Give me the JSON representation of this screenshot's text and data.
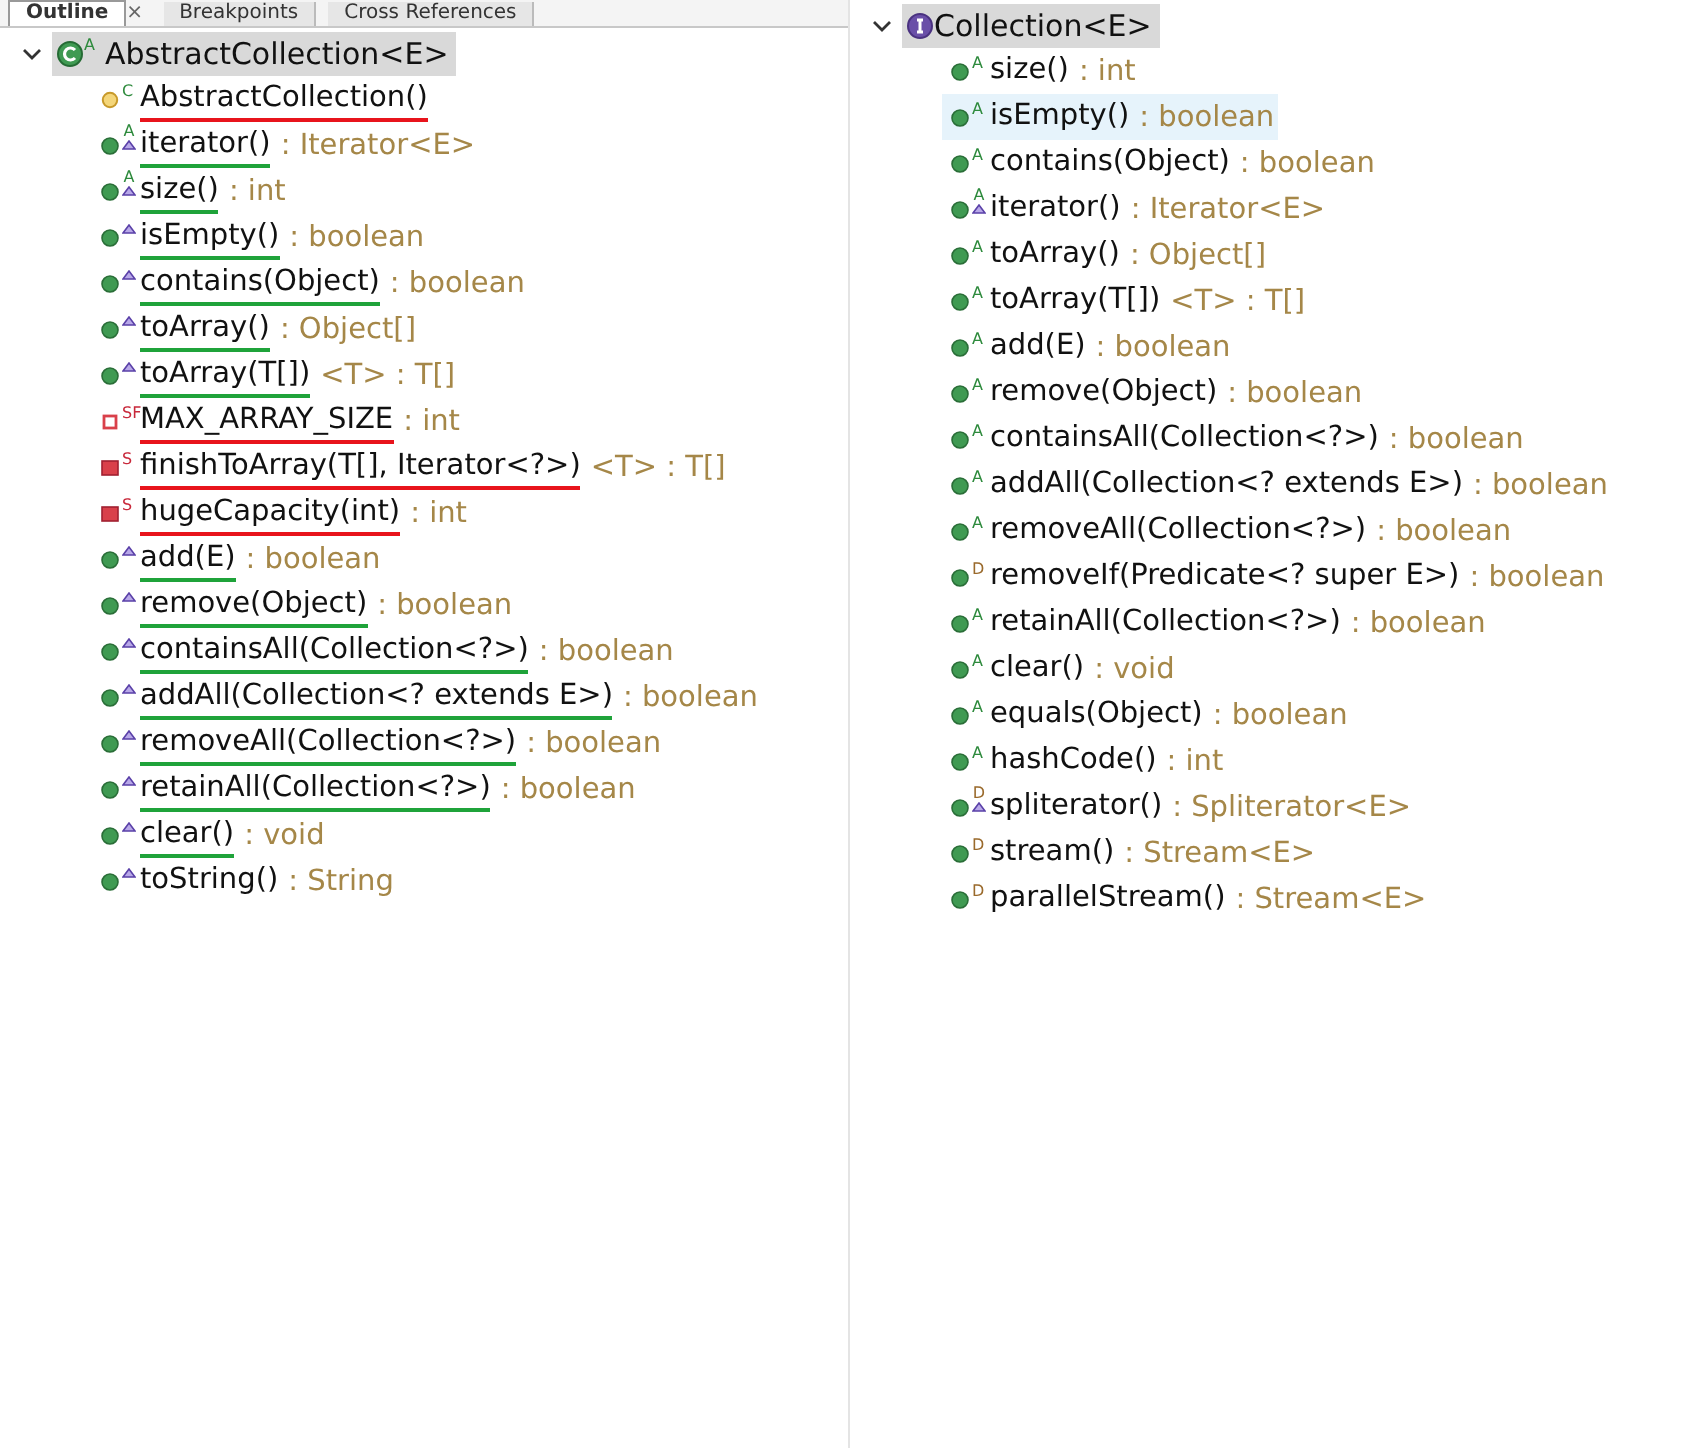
{
  "tabs": [
    {
      "label": "Outline",
      "selected": true,
      "close": "×"
    },
    {
      "label": "Breakpoints",
      "selected": false
    },
    {
      "label": "Cross References",
      "selected": false
    }
  ],
  "outline": {
    "root": {
      "label": "AbstractCollection<E>",
      "kind": "class",
      "modifier": "A",
      "expanded": true,
      "selected": true
    },
    "members": [
      {
        "signature": "AbstractCollection()",
        "kind": "constructor",
        "modifier": "C",
        "overrides": false,
        "color": "#e8141c",
        "selected": false
      },
      {
        "signature": "iterator()",
        "return": ": Iterator<E>",
        "kind": "public",
        "modifier": "A",
        "overrides": true,
        "color": "#1fa33a",
        "selected": false
      },
      {
        "signature": "size()",
        "return": ": int",
        "kind": "public",
        "modifier": "A",
        "overrides": true,
        "color": "#1fa33a",
        "selected": false
      },
      {
        "signature": "isEmpty()",
        "return": ": boolean",
        "kind": "public",
        "overrides": true,
        "color": "#1fa33a",
        "selected": false
      },
      {
        "signature": "contains(Object)",
        "return": ": boolean",
        "kind": "public",
        "overrides": true,
        "color": "#1fa33a",
        "selected": false
      },
      {
        "signature": "toArray()",
        "return": ": Object[]",
        "kind": "public",
        "overrides": true,
        "color": "#1fa33a",
        "selected": false
      },
      {
        "signature": "toArray(T[])",
        "return": "<T> : T[]",
        "kind": "public",
        "overrides": true,
        "color": "#1fa33a",
        "selected": false
      },
      {
        "signature": "MAX_ARRAY_SIZE",
        "return": ": int",
        "kind": "field",
        "modifier": "SF",
        "overrides": false,
        "color": "#e8141c",
        "selected": false
      },
      {
        "signature": "finishToArray(T[], Iterator<?>)",
        "return": "<T> : T[]",
        "kind": "private",
        "modifier": "S",
        "overrides": false,
        "color": "#e8141c",
        "selected": false
      },
      {
        "signature": "hugeCapacity(int)",
        "return": ": int",
        "kind": "private",
        "modifier": "S",
        "overrides": false,
        "color": "#e8141c",
        "selected": false
      },
      {
        "signature": "add(E)",
        "return": ": boolean",
        "kind": "public",
        "overrides": true,
        "color": "#1fa33a",
        "selected": false
      },
      {
        "signature": "remove(Object)",
        "return": ": boolean",
        "kind": "public",
        "overrides": true,
        "color": "#1fa33a",
        "selected": false
      },
      {
        "signature": "containsAll(Collection<?>)",
        "return": ": boolean",
        "kind": "public",
        "overrides": true,
        "color": "#1fa33a",
        "selected": false
      },
      {
        "signature": "addAll(Collection<? extends E>)",
        "return": ": boolean",
        "kind": "public",
        "overrides": true,
        "color": "#1fa33a",
        "selected": false
      },
      {
        "signature": "removeAll(Collection<?>)",
        "return": ": boolean",
        "kind": "public",
        "overrides": true,
        "color": "#1fa33a",
        "selected": false
      },
      {
        "signature": "retainAll(Collection<?>)",
        "return": ": boolean",
        "kind": "public",
        "overrides": true,
        "color": "#1fa33a",
        "selected": false
      },
      {
        "signature": "clear()",
        "return": ": void",
        "kind": "public",
        "overrides": true,
        "color": "#1fa33a",
        "selected": false
      },
      {
        "signature": "toString()",
        "return": ": String",
        "kind": "public",
        "overrides": true,
        "selected": false
      }
    ]
  },
  "hierarchy": {
    "root": {
      "label": "Collection<E>",
      "kind": "interface",
      "expanded": true,
      "selected": true
    },
    "members": [
      {
        "signature": "size()",
        "return": ": int",
        "kind": "public",
        "modifier": "A",
        "overrides": false,
        "selected": false
      },
      {
        "signature": "isEmpty()",
        "return": ": boolean",
        "kind": "public",
        "modifier": "A",
        "overrides": false,
        "selected": true
      },
      {
        "signature": "contains(Object)",
        "return": ": boolean",
        "kind": "public",
        "modifier": "A",
        "overrides": false,
        "selected": false
      },
      {
        "signature": "iterator()",
        "return": ": Iterator<E>",
        "kind": "public",
        "modifier": "A",
        "overrides": true,
        "selected": false
      },
      {
        "signature": "toArray()",
        "return": ": Object[]",
        "kind": "public",
        "modifier": "A",
        "overrides": false,
        "selected": false
      },
      {
        "signature": "toArray(T[])",
        "return": "<T> : T[]",
        "kind": "public",
        "modifier": "A",
        "overrides": false,
        "selected": false
      },
      {
        "signature": "add(E)",
        "return": ": boolean",
        "kind": "public",
        "modifier": "A",
        "overrides": false,
        "selected": false
      },
      {
        "signature": "remove(Object)",
        "return": ": boolean",
        "kind": "public",
        "modifier": "A",
        "overrides": false,
        "selected": false
      },
      {
        "signature": "containsAll(Collection<?>)",
        "return": ": boolean",
        "kind": "public",
        "modifier": "A",
        "overrides": false,
        "selected": false
      },
      {
        "signature": "addAll(Collection<? extends E>)",
        "return": ": boolean",
        "kind": "public",
        "modifier": "A",
        "overrides": false,
        "selected": false
      },
      {
        "signature": "removeAll(Collection<?>)",
        "return": ": boolean",
        "kind": "public",
        "modifier": "A",
        "overrides": false,
        "selected": false
      },
      {
        "signature": "removeIf(Predicate<? super E>)",
        "return": ": boolean",
        "kind": "public",
        "modifier": "D",
        "overrides": false,
        "selected": false
      },
      {
        "signature": "retainAll(Collection<?>)",
        "return": ": boolean",
        "kind": "public",
        "modifier": "A",
        "overrides": false,
        "selected": false
      },
      {
        "signature": "clear()",
        "return": ": void",
        "kind": "public",
        "modifier": "A",
        "overrides": false,
        "selected": false
      },
      {
        "signature": "equals(Object)",
        "return": ": boolean",
        "kind": "public",
        "modifier": "A",
        "overrides": false,
        "selected": false
      },
      {
        "signature": "hashCode()",
        "return": ": int",
        "kind": "public",
        "modifier": "A",
        "overrides": false,
        "selected": false
      },
      {
        "signature": "spliterator()",
        "return": ": Spliterator<E>",
        "kind": "public",
        "modifier": "D",
        "overrides": true,
        "selected": false
      },
      {
        "signature": "stream()",
        "return": ": Stream<E>",
        "kind": "public",
        "modifier": "D",
        "overrides": false,
        "selected": false
      },
      {
        "signature": "parallelStream()",
        "return": ": Stream<E>",
        "kind": "public",
        "modifier": "D",
        "overrides": false,
        "selected": false
      }
    ]
  }
}
